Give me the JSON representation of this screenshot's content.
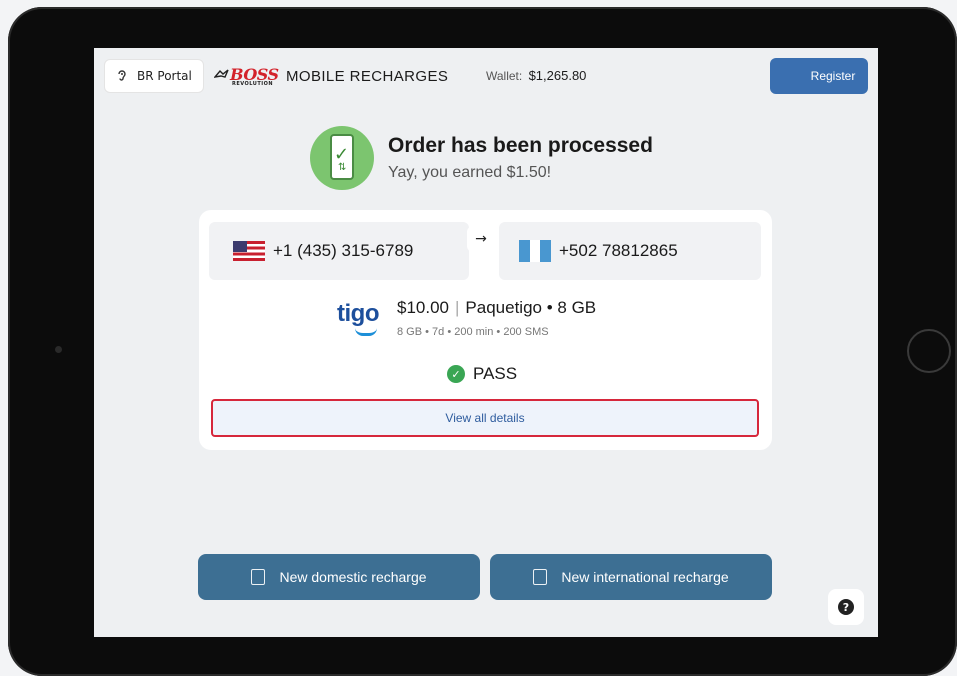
{
  "header": {
    "portal_label": "BR Portal",
    "brand_logo_text": "BOSS",
    "brand_logo_subtext": "REVOLUTION",
    "brand_title": "MOBILE RECHARGES",
    "wallet_label": "Wallet:",
    "wallet_value": "$1,265.80",
    "register_label": "Register"
  },
  "status": {
    "title": "Order has been processed",
    "subtitle": "Yay, you earned $1.50!"
  },
  "order": {
    "from_number": "+1 (435) 315-6789",
    "to_number": "+502 78812865",
    "arrow": "→",
    "operator_logo": "tigo",
    "amount": "$10.00",
    "plan_name": "Paquetigo • 8 GB",
    "plan_details": "8 GB • 7d • 200 min • 200 SMS",
    "result": "PASS",
    "view_details_label": "View all details"
  },
  "actions": {
    "domestic_label": "New domestic recharge",
    "international_label": "New international recharge"
  },
  "help": {
    "label": "?"
  },
  "colors": {
    "primary_blue": "#3a6fb0",
    "action_button": "#3d6f93",
    "success_green": "#3aa654",
    "highlight_red": "#d6273b",
    "boss_red": "#d3222a",
    "tigo_blue": "#1d4f9c"
  },
  "icons": {
    "portal": "ear-icon",
    "status": "phone-check-icon",
    "pass": "check-circle-icon",
    "domestic": "phone-recharge-icon",
    "international": "phone-globe-icon",
    "help": "question-icon"
  }
}
